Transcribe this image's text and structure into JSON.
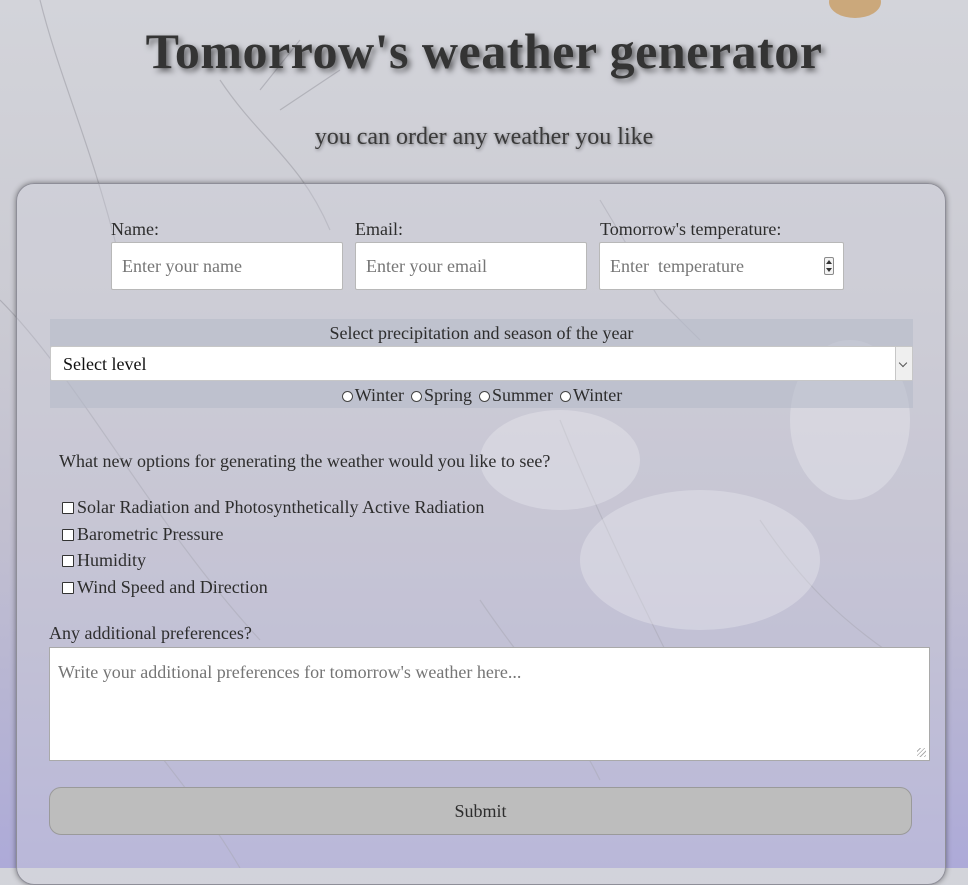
{
  "header": {
    "title": "Tomorrow's weather generator",
    "subtitle": "you can order any weather you like"
  },
  "form": {
    "name": {
      "label": "Name:",
      "placeholder": "Enter your name"
    },
    "email": {
      "label": "Email:",
      "placeholder": "Enter your email"
    },
    "temperature": {
      "label": "Tomorrow's temperature:",
      "placeholder": "Enter  temperature"
    },
    "precipitation": {
      "title": "Select precipitation and season of the year",
      "select_value": "Select level",
      "seasons": [
        "Winter",
        "Spring",
        "Summer",
        "Winter"
      ]
    },
    "options": {
      "question": "What new options for generating the weather would you like to see?",
      "items": [
        "Solar Radiation and Photosynthetically Active Radiation",
        "Barometric Pressure",
        "Humidity",
        "Wind Speed and Direction"
      ]
    },
    "additional": {
      "label": "Any additional preferences?",
      "placeholder": "Write your additional preferences for tomorrow's weather here..."
    },
    "submit_label": "Submit"
  },
  "colors": {
    "title": "#343434",
    "button": "#bdbdbd",
    "panel": "#b4bac8"
  }
}
